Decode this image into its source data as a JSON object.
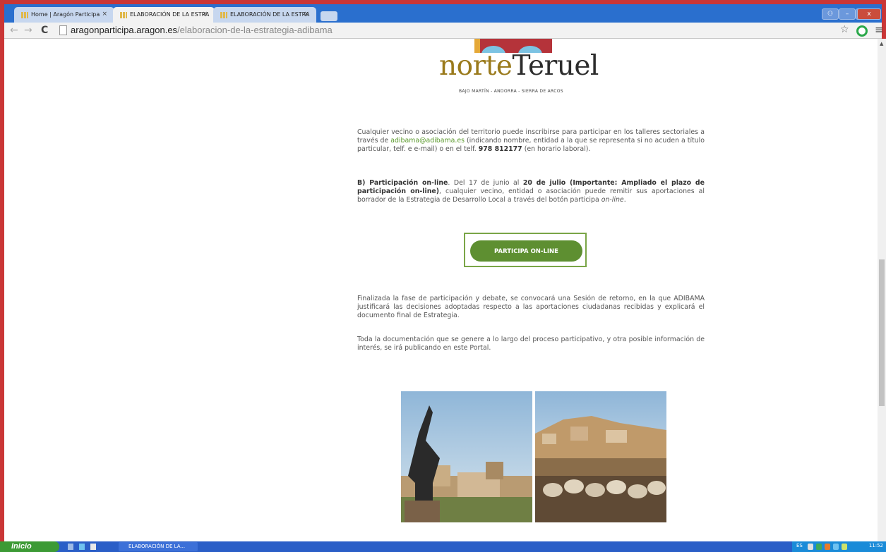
{
  "browser": {
    "tabs": [
      {
        "title": "Home | Aragón Participa",
        "active": false
      },
      {
        "title": "ELABORACIÓN DE LA ESTRA",
        "active": true
      },
      {
        "title": "ELABORACIÓN DE LA ESTRA",
        "active": false
      }
    ],
    "tab_close": "×",
    "url_host": "aragonparticipa.aragon.es",
    "url_path": "/elaboracion-de-la-estrategia-adibama",
    "back": "←",
    "forward": "→",
    "reload": "C",
    "star": "☆",
    "menu": "≡",
    "window_controls": {
      "minimize": "–",
      "maximize": "▭",
      "close": "x",
      "extra": "⚇"
    }
  },
  "logo": {
    "text_accent": "norte",
    "text_main": "Teruel",
    "subtitle": "BAJO MARTÍN - ANDORRA - SIERRA DE ARCOS"
  },
  "content": {
    "p1_a": "Cualquier vecino o asociación del territorio puede inscribirse para participar en los talleres sectoriales a través de ",
    "p1_email": "adibama@adibama.es",
    "p1_b": " (indicando nombre, entidad a la que se representa si no acuden a título particular, telf. e e-mail) o en el telf. ",
    "p1_phone": "978 812177",
    "p1_c": " (en horario laboral).",
    "p2_bold1": "B) Participación on-line",
    "p2_a": ". Del 17 de junio al ",
    "p2_bold2": "20 de julio (Importante: Ampliado el plazo de participación on-line)",
    "p2_b": ", cualquier vecino, entidad o asociación puede remitir sus aportaciones al borrador de la Estrategia de Desarrollo Local a través del botón participa ",
    "p2_italic": "on-line",
    "p2_c": ".",
    "cta_label": "PARTICIPA ON-LINE",
    "p3": "Finalizada la fase de participación y debate, se convocará una Sesión de retorno, en la que ADIBAMA justificará las decisiones adoptadas respecto a las aportaciones ciudadanas recibidas y explicará el documento final de Estrategia.",
    "p4": "Toda la documentación que se genere a lo largo del proceso participativo, y otra posible información de interés, se irá publicando en este Portal."
  },
  "taskbar": {
    "start": "Inicio",
    "task": "ELABORACIÓN DE LA...",
    "lang": "ES",
    "clock": "11:52"
  },
  "colors": {
    "accent_green": "#5e8f31",
    "link_green": "#5b9a2c",
    "logo_gold": "#9a7a1c"
  }
}
